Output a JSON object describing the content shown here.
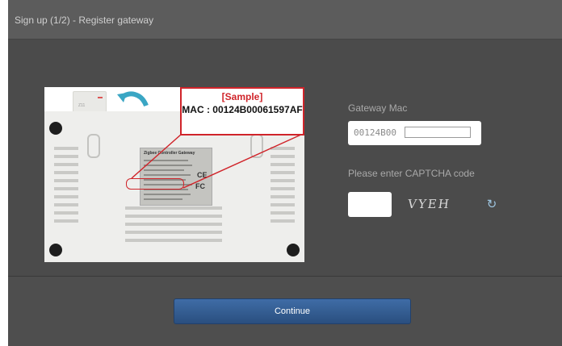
{
  "window": {
    "title": "Sign up (1/2) - Register gateway"
  },
  "sample_image": {
    "title": "[Sample]",
    "mac_text": "MAC : 00124B00061597AF",
    "accent_color": "#d0242a",
    "icons": [
      "arrow-icon",
      "gateway-device-icon"
    ]
  },
  "form": {
    "gateway_mac_label": "Gateway Mac",
    "mac_prefix": "00124B00",
    "mac_value": "",
    "captcha_label": "Please enter CAPTCHA code",
    "captcha_value": "",
    "captcha_text": "VYEH",
    "refresh_icon": "refresh-icon"
  },
  "footer": {
    "continue_label": "Continue",
    "button_color": "#2f5a90"
  }
}
